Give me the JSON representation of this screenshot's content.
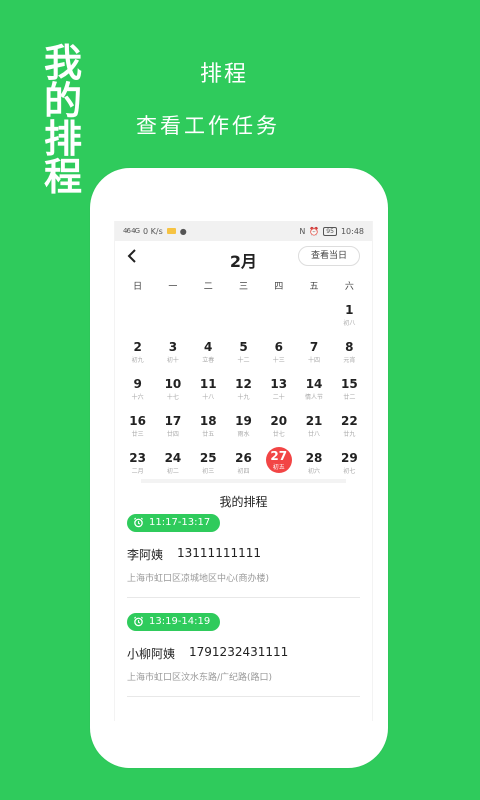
{
  "promo": {
    "vertical_title": [
      "我",
      "的",
      "排",
      "程"
    ],
    "headline": "排程",
    "subheadline": "查看工作任务"
  },
  "status_bar": {
    "network_left": "46 4G",
    "speed": "0 K/s",
    "time": "10:48",
    "battery": "95"
  },
  "calendar": {
    "month": "2月",
    "today_button": "查看当日",
    "weekdays": [
      "日",
      "一",
      "二",
      "三",
      "四",
      "五",
      "六"
    ],
    "days": [
      {
        "num": "",
        "lunar": ""
      },
      {
        "num": "",
        "lunar": ""
      },
      {
        "num": "",
        "lunar": ""
      },
      {
        "num": "",
        "lunar": ""
      },
      {
        "num": "",
        "lunar": ""
      },
      {
        "num": "",
        "lunar": ""
      },
      {
        "num": "1",
        "lunar": "初八"
      },
      {
        "num": "2",
        "lunar": "初九"
      },
      {
        "num": "3",
        "lunar": "初十"
      },
      {
        "num": "4",
        "lunar": "立春"
      },
      {
        "num": "5",
        "lunar": "十二"
      },
      {
        "num": "6",
        "lunar": "十三"
      },
      {
        "num": "7",
        "lunar": "十四"
      },
      {
        "num": "8",
        "lunar": "元宵"
      },
      {
        "num": "9",
        "lunar": "十六"
      },
      {
        "num": "10",
        "lunar": "十七"
      },
      {
        "num": "11",
        "lunar": "十八"
      },
      {
        "num": "12",
        "lunar": "十九"
      },
      {
        "num": "13",
        "lunar": "二十"
      },
      {
        "num": "14",
        "lunar": "情人节"
      },
      {
        "num": "15",
        "lunar": "廿二"
      },
      {
        "num": "16",
        "lunar": "廿三"
      },
      {
        "num": "17",
        "lunar": "廿四"
      },
      {
        "num": "18",
        "lunar": "廿五"
      },
      {
        "num": "19",
        "lunar": "雨水"
      },
      {
        "num": "20",
        "lunar": "廿七"
      },
      {
        "num": "21",
        "lunar": "廿八"
      },
      {
        "num": "22",
        "lunar": "廿九"
      },
      {
        "num": "23",
        "lunar": "二月"
      },
      {
        "num": "24",
        "lunar": "初二"
      },
      {
        "num": "25",
        "lunar": "初三"
      },
      {
        "num": "26",
        "lunar": "初四"
      },
      {
        "num": "27",
        "lunar": "初五",
        "selected": true
      },
      {
        "num": "28",
        "lunar": "初六"
      },
      {
        "num": "29",
        "lunar": "初七"
      }
    ],
    "selected_color": "#f24545"
  },
  "schedule": {
    "title": "我的排程",
    "entries": [
      {
        "time": "11:17-13:17",
        "name": "李阿姨",
        "phone": "13111111111",
        "address": "上海市虹口区凉城地区中心(商办楼)"
      },
      {
        "time": "13:19-14:19",
        "name": "小柳阿姨",
        "phone": "1791232431111",
        "address": "上海市虹口区汶水东路/广纪路(路口)"
      }
    ]
  },
  "colors": {
    "brand_green": "#2fcb5c"
  }
}
